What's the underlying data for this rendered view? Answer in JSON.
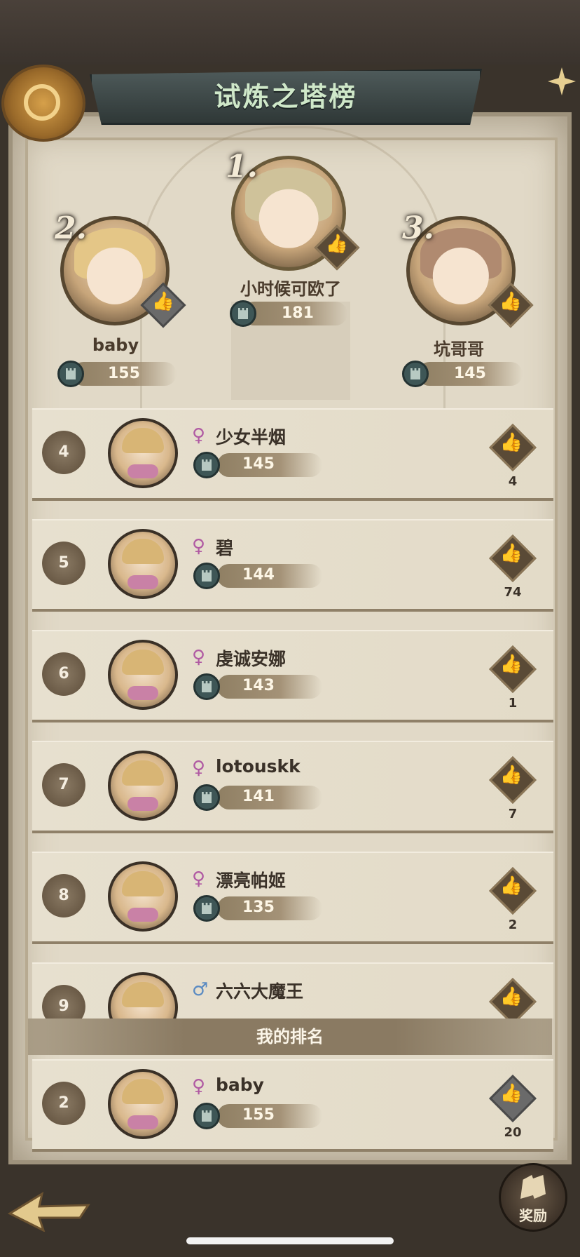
{
  "header": {
    "title": "试炼之塔榜"
  },
  "podium": [
    {
      "rank": "1.",
      "name": "小时候可欧了",
      "score": "181"
    },
    {
      "rank": "2.",
      "name": "baby",
      "score": "155"
    },
    {
      "rank": "3.",
      "name": "坑哥哥",
      "score": "145"
    }
  ],
  "list": [
    {
      "rank": "4",
      "gender": "♀",
      "name": "少女半烟",
      "score": "145",
      "likes": "4"
    },
    {
      "rank": "5",
      "gender": "♀",
      "name": "碧",
      "score": "144",
      "likes": "74"
    },
    {
      "rank": "6",
      "gender": "♀",
      "name": "虔诚安娜",
      "score": "143",
      "likes": "1"
    },
    {
      "rank": "7",
      "gender": "♀",
      "name": "lotouskk",
      "score": "141",
      "likes": "7"
    },
    {
      "rank": "8",
      "gender": "♀",
      "name": "漂亮帕姬",
      "score": "135",
      "likes": "2"
    },
    {
      "rank": "9",
      "gender": "♂",
      "name": "六六大魔王",
      "score": "",
      "likes": ""
    }
  ],
  "my_rank": {
    "label": "我的排名",
    "rank": "2",
    "gender": "♀",
    "name": "baby",
    "score": "155",
    "likes": "20"
  },
  "footer": {
    "rewards_label": "奖励"
  },
  "icons": {
    "like": "thumbs-up-icon",
    "tower": "tower-icon",
    "back": "back-arrow-icon",
    "rewards": "rewards-icon"
  }
}
